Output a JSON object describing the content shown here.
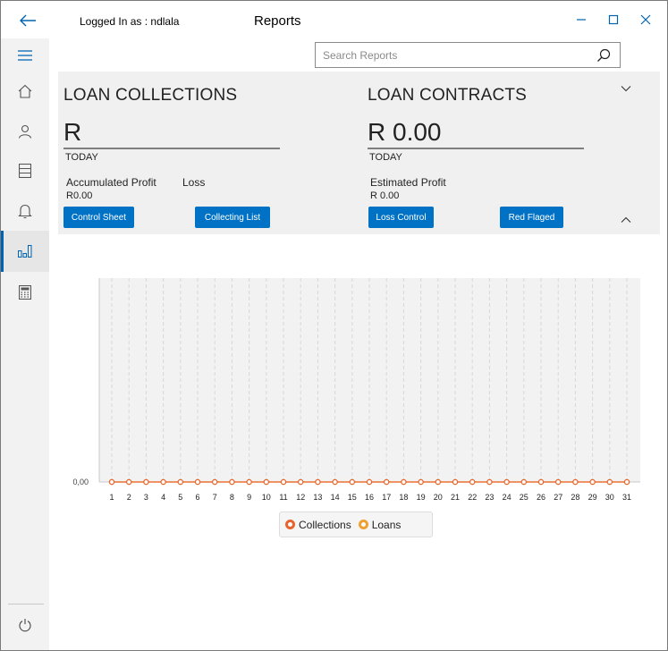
{
  "titlebar": {
    "logged_in": "Logged In as : ndlala",
    "title": "Reports"
  },
  "search": {
    "placeholder": "Search Reports"
  },
  "collections": {
    "title": "LOAN COLLECTIONS",
    "value": "R",
    "period": "TODAY",
    "accumulated_label": "Accumulated Profit",
    "loss_label": "Loss",
    "accumulated_value": "R0.00",
    "control_sheet": "Control Sheet",
    "collecting_list": "Collecting List"
  },
  "contracts": {
    "title": "LOAN CONTRACTS",
    "value": "R 0.00",
    "period": "TODAY",
    "estimated_label": "Estimated Profit",
    "estimated_value": "R 0.00",
    "loss_control": "Loss Control",
    "red_flaged": "Red Flaged"
  },
  "colors": {
    "accent": "#0072c6",
    "collections": "#e8642c",
    "loans": "#f0a030"
  },
  "chart_data": {
    "type": "line",
    "x": [
      "1",
      "2",
      "3",
      "4",
      "5",
      "6",
      "7",
      "8",
      "9",
      "10",
      "11",
      "12",
      "13",
      "14",
      "15",
      "16",
      "17",
      "18",
      "19",
      "20",
      "21",
      "22",
      "23",
      "24",
      "25",
      "26",
      "27",
      "28",
      "29",
      "30",
      "31"
    ],
    "y_ticks": [
      "0,00"
    ],
    "series": [
      {
        "name": "Collections",
        "values": [
          0,
          0,
          0,
          0,
          0,
          0,
          0,
          0,
          0,
          0,
          0,
          0,
          0,
          0,
          0,
          0,
          0,
          0,
          0,
          0,
          0,
          0,
          0,
          0,
          0,
          0,
          0,
          0,
          0,
          0,
          0
        ]
      },
      {
        "name": "Loans",
        "values": [
          0,
          0,
          0,
          0,
          0,
          0,
          0,
          0,
          0,
          0,
          0,
          0,
          0,
          0,
          0,
          0,
          0,
          0,
          0,
          0,
          0,
          0,
          0,
          0,
          0,
          0,
          0,
          0,
          0,
          0,
          0
        ]
      }
    ],
    "grid": true,
    "legend": "bottom"
  }
}
